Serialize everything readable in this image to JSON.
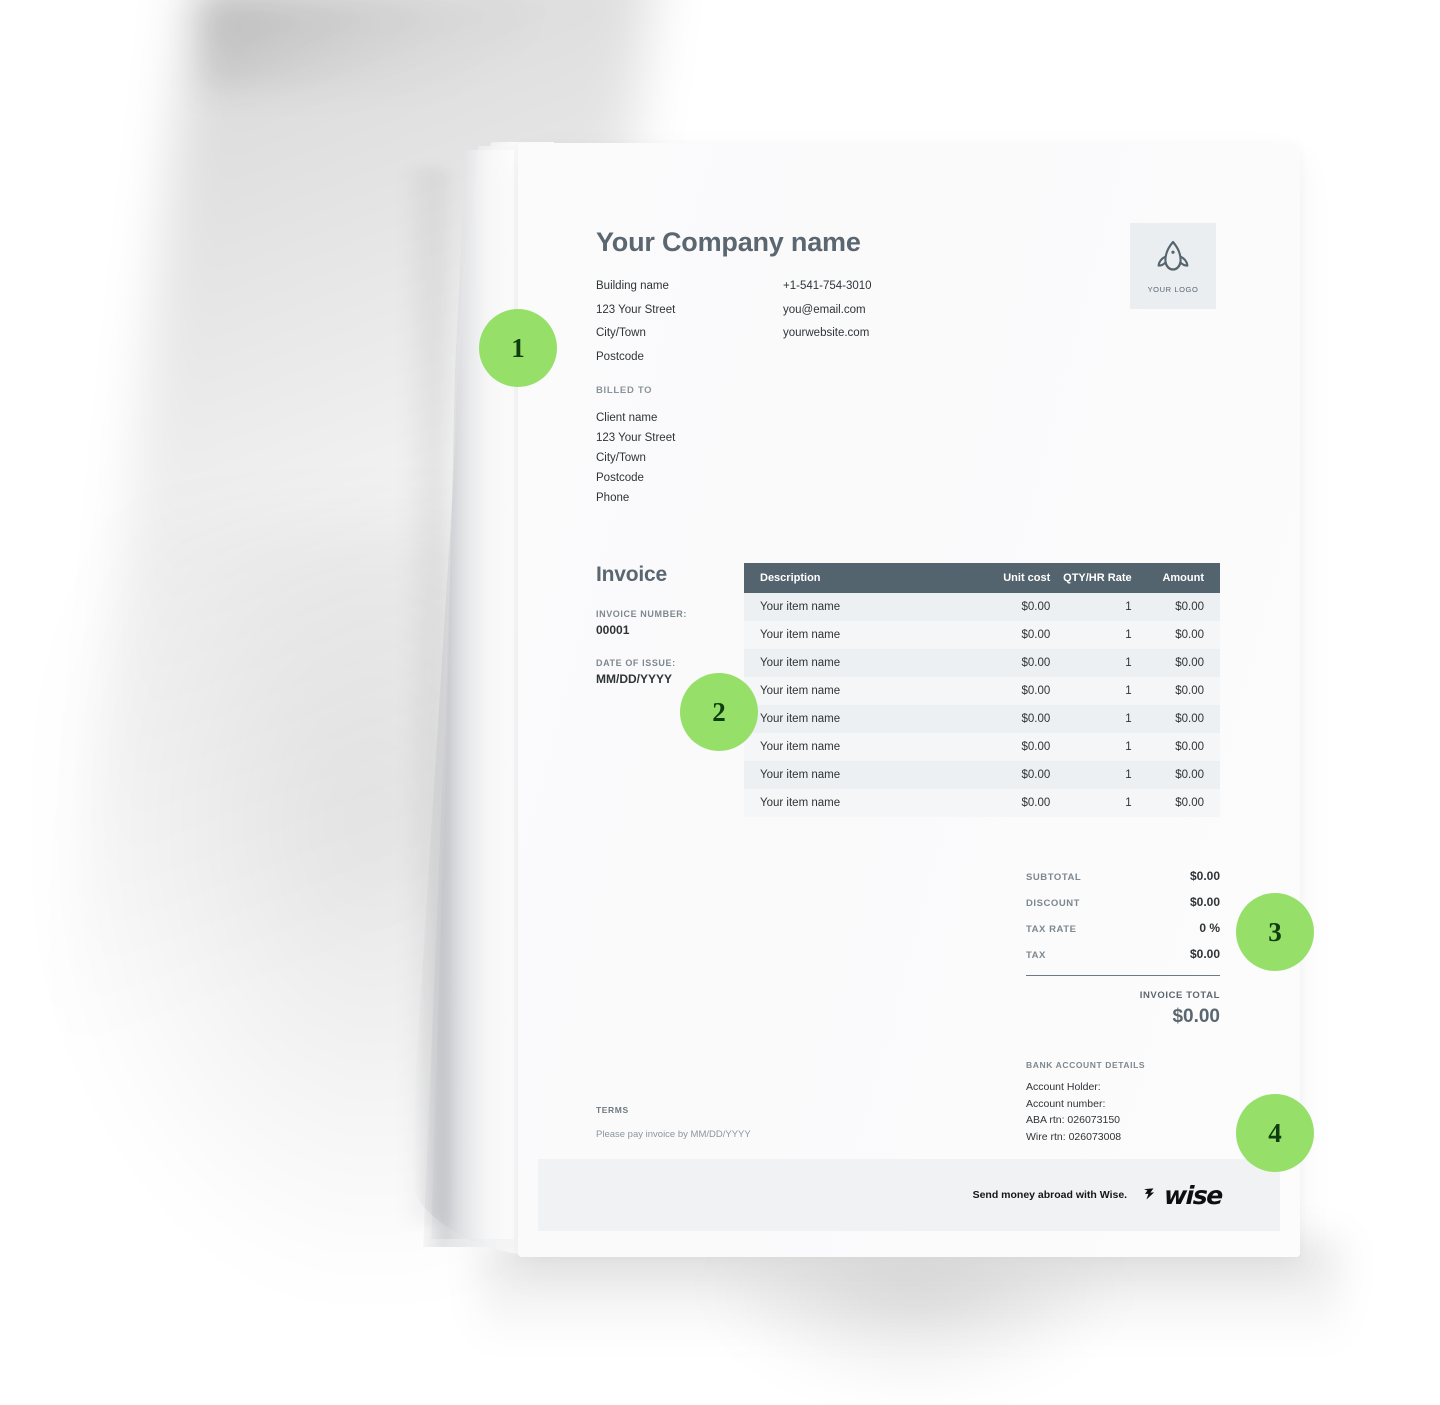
{
  "company": {
    "name": "Your Company name",
    "address": [
      "Building name",
      "123 Your Street",
      "City/Town",
      "Postcode"
    ],
    "contact": [
      "+1-541-754-3010",
      "you@email.com",
      "yourwebsite.com"
    ]
  },
  "logo": {
    "caption": "YOUR LOGO",
    "icon": "rocket-icon",
    "background": "#eaeef1"
  },
  "billed_to": {
    "label": "BILLED TO",
    "lines": [
      "Client name",
      "123 Your Street",
      "City/Town",
      "Postcode",
      "Phone"
    ]
  },
  "invoice": {
    "title": "Invoice",
    "number_label": "INVOICE NUMBER:",
    "number_value": "00001",
    "date_label": "DATE OF ISSUE:",
    "date_value": "MM/DD/YYYY"
  },
  "table": {
    "headers": [
      "Description",
      "Unit cost",
      "QTY/HR Rate",
      "Amount"
    ],
    "header_background": "#54646e",
    "rows": [
      {
        "description": "Your item name",
        "unit_cost": "$0.00",
        "qty": "1",
        "amount": "$0.00"
      },
      {
        "description": "Your item name",
        "unit_cost": "$0.00",
        "qty": "1",
        "amount": "$0.00"
      },
      {
        "description": "Your item name",
        "unit_cost": "$0.00",
        "qty": "1",
        "amount": "$0.00"
      },
      {
        "description": "Your item name",
        "unit_cost": "$0.00",
        "qty": "1",
        "amount": "$0.00"
      },
      {
        "description": "Your item name",
        "unit_cost": "$0.00",
        "qty": "1",
        "amount": "$0.00"
      },
      {
        "description": "Your item name",
        "unit_cost": "$0.00",
        "qty": "1",
        "amount": "$0.00"
      },
      {
        "description": "Your item name",
        "unit_cost": "$0.00",
        "qty": "1",
        "amount": "$0.00"
      },
      {
        "description": "Your item name",
        "unit_cost": "$0.00",
        "qty": "1",
        "amount": "$0.00"
      }
    ]
  },
  "totals": {
    "rows": [
      {
        "label": "SUBTOTAL",
        "value": "$0.00"
      },
      {
        "label": "DISCOUNT",
        "value": "$0.00"
      },
      {
        "label": "TAX RATE",
        "value": "0 %"
      },
      {
        "label": "TAX",
        "value": "$0.00"
      }
    ],
    "grand_label": "INVOICE TOTAL",
    "grand_value": "$0.00"
  },
  "bank": {
    "label": "BANK ACCOUNT DETAILS",
    "lines": [
      "Account Holder:",
      "Account number:",
      "ABA rtn: 026073150",
      "Wire rtn: 026073008"
    ]
  },
  "terms": {
    "label": "TERMS",
    "text": "Please pay invoice by MM/DD/YYYY"
  },
  "footer": {
    "text": "Send money abroad with Wise.",
    "brand": "wise"
  },
  "markers": [
    {
      "number": "1"
    },
    {
      "number": "2"
    },
    {
      "number": "3"
    },
    {
      "number": "4"
    }
  ],
  "theme": {
    "accent_green": "#96e06a",
    "marker_text": "#0f3d10",
    "heading_gray": "#5b6770",
    "row_odd": "#edf0f3",
    "row_even": "#f4f6f8"
  }
}
